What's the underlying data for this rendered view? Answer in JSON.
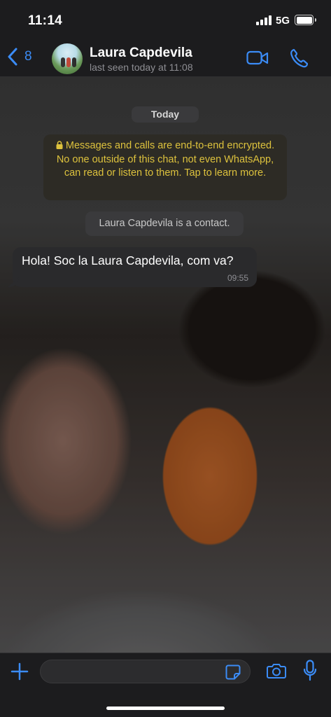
{
  "status_bar": {
    "time": "11:14",
    "network": "5G"
  },
  "header": {
    "back_count": "8",
    "contact_name": "Laura Capdevila",
    "last_seen": "last seen today at 11:08"
  },
  "chat": {
    "date_label": "Today",
    "encryption_notice": "Messages and calls are end-to-end encrypted. No one outside of this chat, not even WhatsApp, can read or listen to them. Tap to learn more.",
    "contact_notice": "Laura Capdevila is a contact.",
    "messages": [
      {
        "text": "Hola! Soc la Laura Capdevila, com va?",
        "time": "09:55"
      }
    ]
  },
  "input": {
    "placeholder": "",
    "value": ""
  },
  "colors": {
    "accent": "#3b8cf7",
    "encryption_text": "#ddc23d",
    "background": "#1c1c1e"
  },
  "icons": [
    "chevron-left-icon",
    "video-icon",
    "phone-icon",
    "plus-icon",
    "sticker-icon",
    "camera-icon",
    "microphone-icon",
    "lock-icon"
  ]
}
